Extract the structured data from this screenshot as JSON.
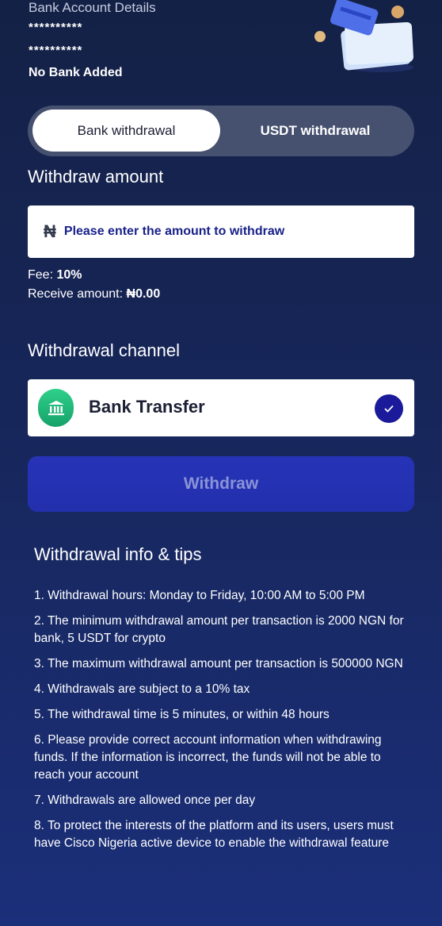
{
  "account": {
    "title": "Bank Account Details",
    "masked_line1": "**********",
    "masked_line2": "**********",
    "status": "No Bank Added"
  },
  "tabs": {
    "bank": "Bank withdrawal",
    "usdt": "USDT withdrawal"
  },
  "amount": {
    "heading": "Withdraw amount",
    "currency_symbol": "₦",
    "placeholder": "Please enter the amount to withdraw"
  },
  "fee": {
    "label": "Fee: ",
    "value": "10%",
    "receive_label": "Receive amount: ",
    "receive_value": "₦0.00"
  },
  "channel": {
    "heading": "Withdrawal channel",
    "name": "Bank Transfer",
    "icon": "bank-icon",
    "selected": true
  },
  "action": {
    "withdraw_label": "Withdraw"
  },
  "tips": {
    "heading": "Withdrawal info & tips",
    "items": [
      "1. Withdrawal hours: Monday to Friday, 10:00 AM to 5:00 PM",
      "2. The minimum withdrawal amount per transaction is 2000 NGN for bank, 5 USDT for crypto",
      "3. The maximum withdrawal amount per transaction is 500000 NGN",
      "4. Withdrawals are subject to a 10% tax",
      "5. The withdrawal time is 5 minutes, or within 48 hours",
      "6. Please provide correct account information when withdrawing funds. If the information is incorrect, the funds will not be able to reach your account",
      "7. Withdrawals are allowed once per day",
      "8. To protect the interests of the platform and its users, users must have Cisco Nigeria active device to enable the withdrawal feature"
    ]
  },
  "colors": {
    "accent": "#2230ad",
    "check": "#1a1a9a",
    "bank_icon": "#17a26a"
  }
}
